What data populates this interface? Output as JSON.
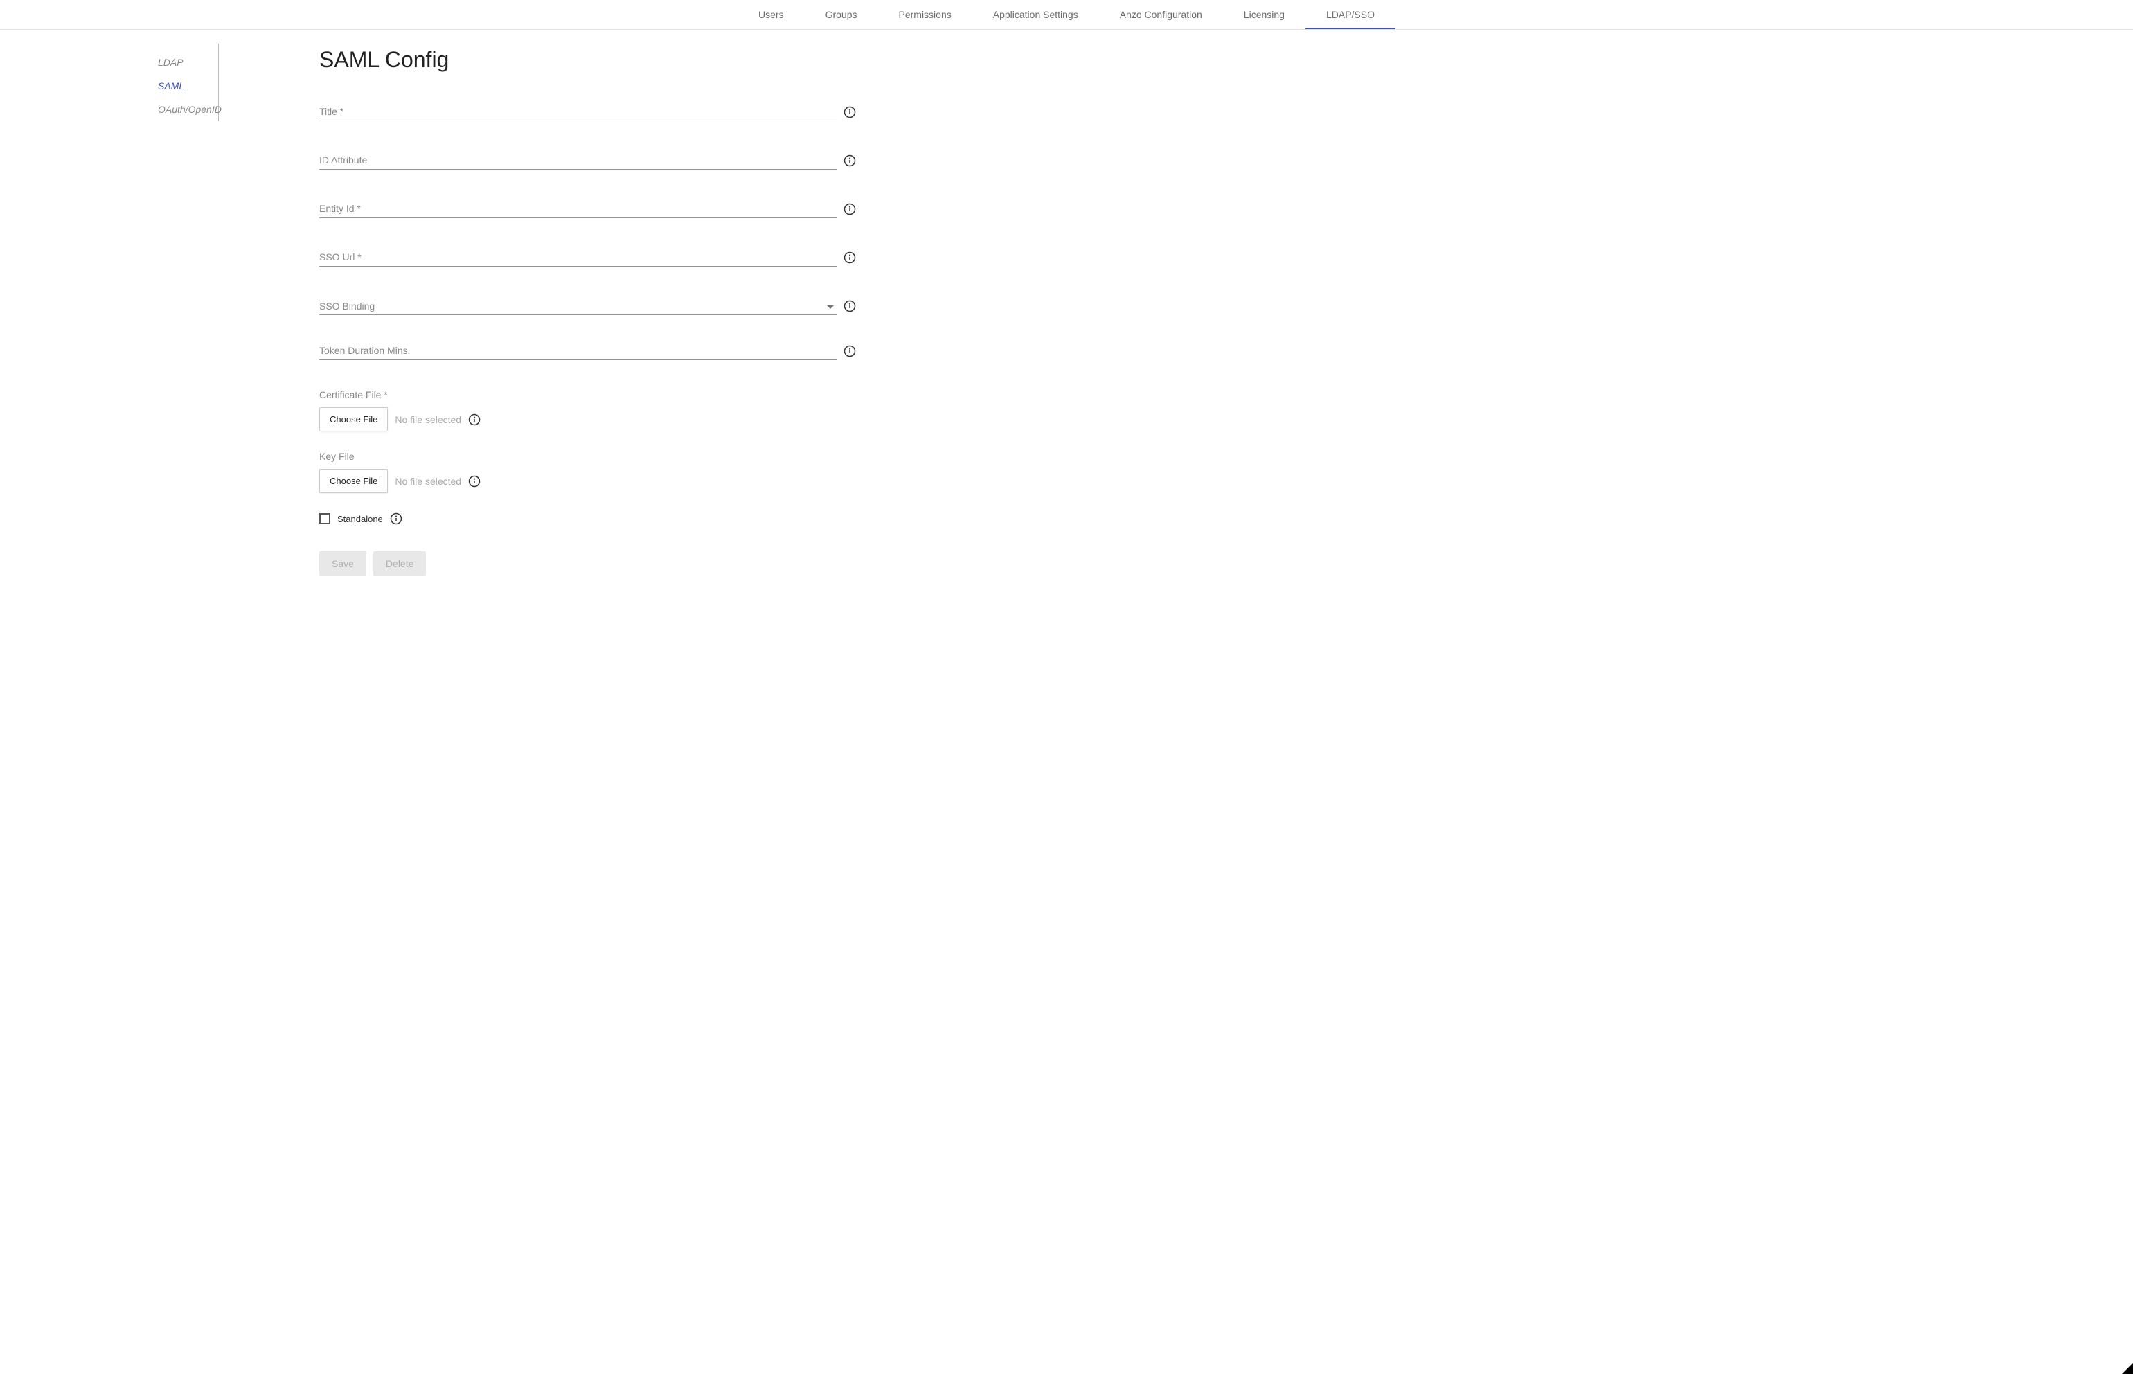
{
  "topNav": {
    "items": [
      {
        "label": "Users"
      },
      {
        "label": "Groups"
      },
      {
        "label": "Permissions"
      },
      {
        "label": "Application Settings"
      },
      {
        "label": "Anzo Configuration"
      },
      {
        "label": "Licensing"
      },
      {
        "label": "LDAP/SSO"
      }
    ],
    "activeIndex": 6
  },
  "sideNav": {
    "items": [
      {
        "label": "LDAP"
      },
      {
        "label": "SAML"
      },
      {
        "label": "OAuth/OpenID"
      }
    ],
    "activeIndex": 1
  },
  "page": {
    "title": "SAML Config"
  },
  "fields": {
    "title": {
      "label": "Title *",
      "value": ""
    },
    "idAttribute": {
      "label": "ID Attribute",
      "value": ""
    },
    "entityId": {
      "label": "Entity Id *",
      "value": ""
    },
    "ssoUrl": {
      "label": "SSO Url *",
      "value": ""
    },
    "ssoBinding": {
      "label": "SSO Binding",
      "value": ""
    },
    "tokenDuration": {
      "label": "Token Duration Mins.",
      "value": ""
    }
  },
  "files": {
    "certificate": {
      "label": "Certificate File *",
      "buttonLabel": "Choose File",
      "status": "No file selected"
    },
    "key": {
      "label": "Key File",
      "buttonLabel": "Choose File",
      "status": "No file selected"
    }
  },
  "standalone": {
    "label": "Standalone",
    "checked": false
  },
  "actions": {
    "save": "Save",
    "delete": "Delete"
  }
}
